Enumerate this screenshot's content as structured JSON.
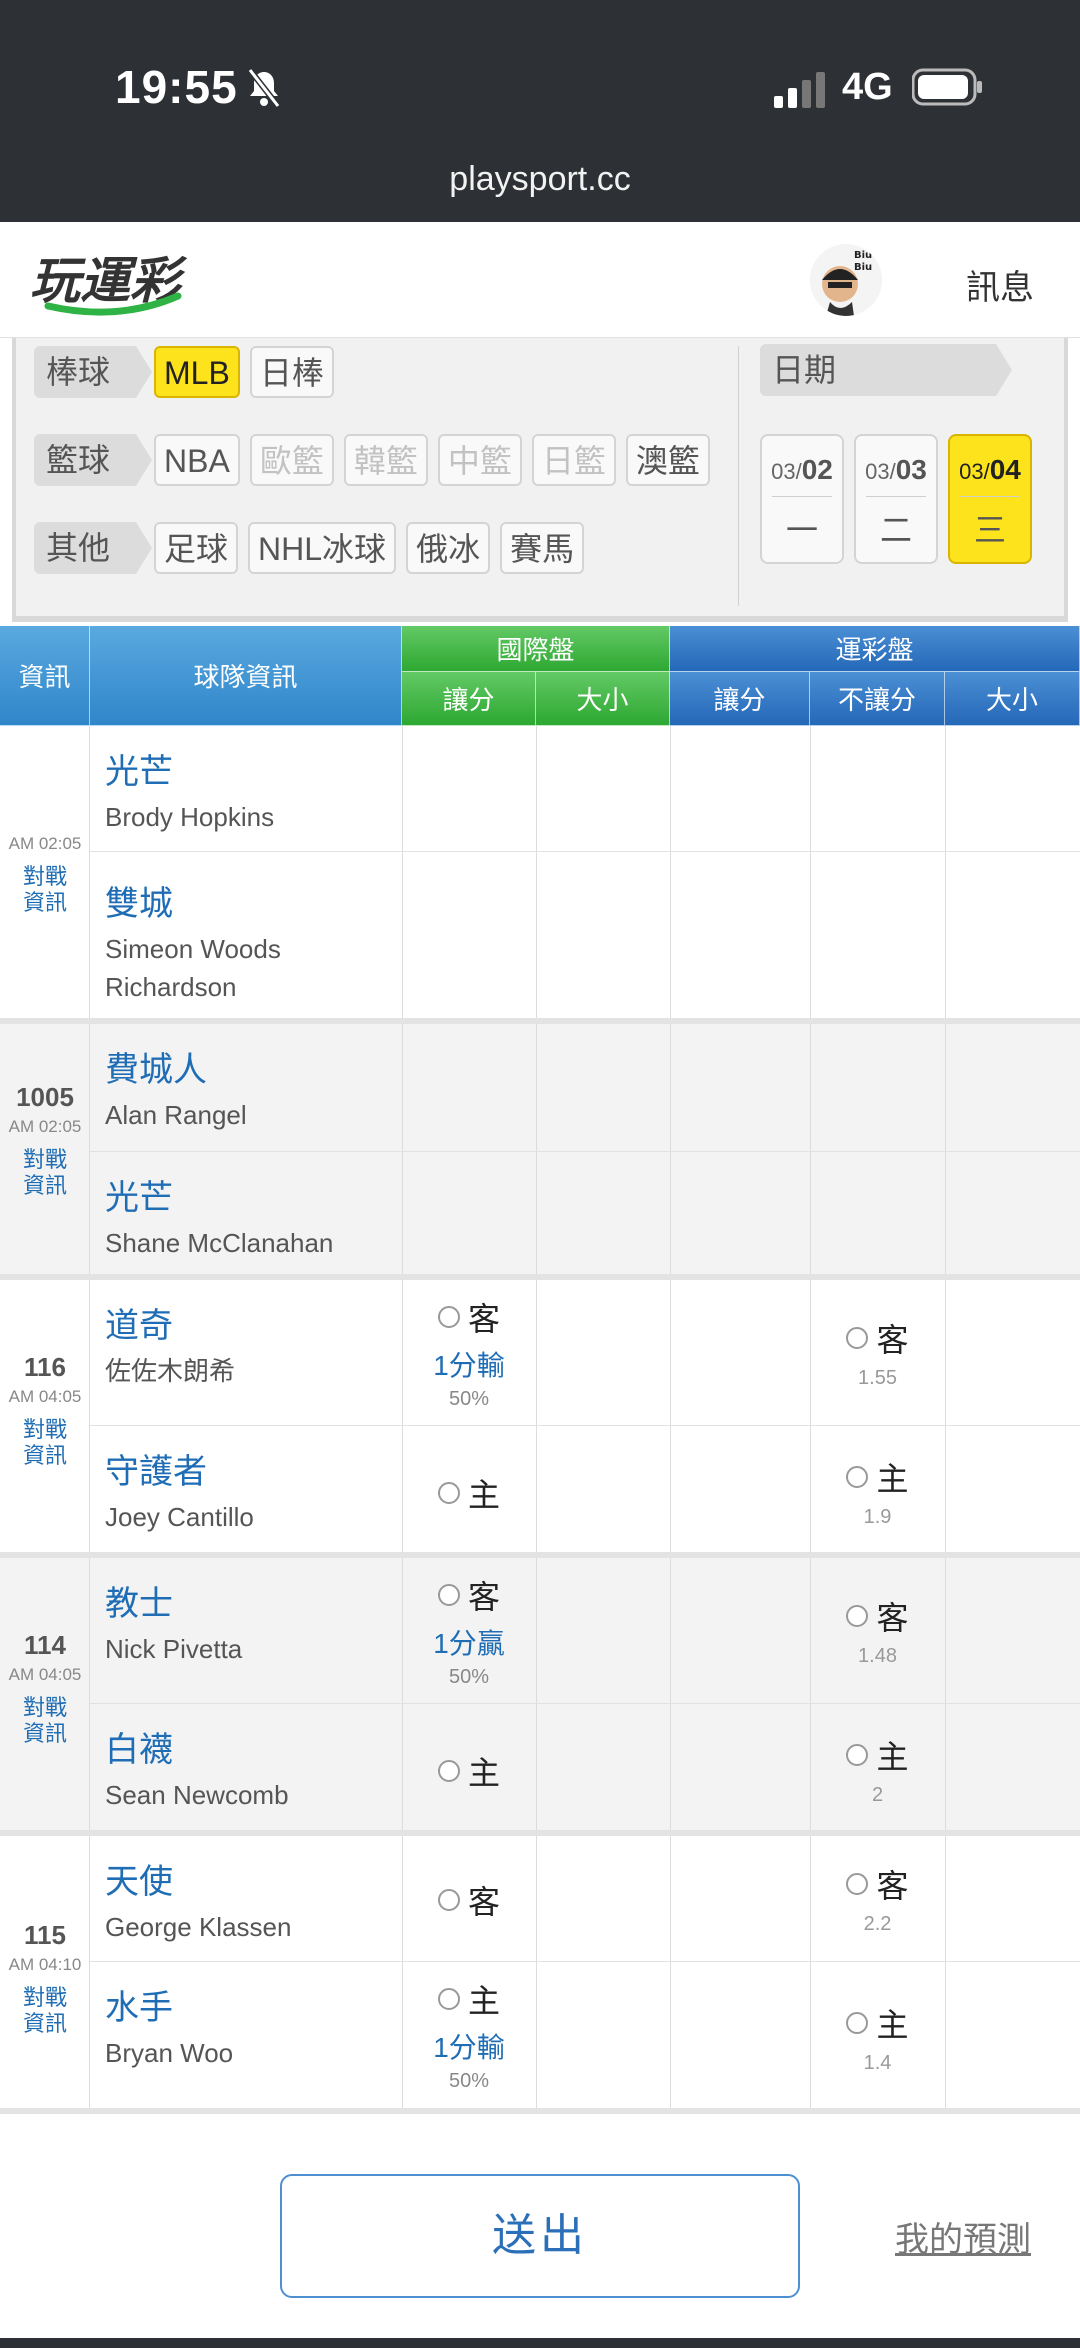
{
  "status_bar": {
    "time": "19:55",
    "network": "4G"
  },
  "url": "playsport.cc",
  "header": {
    "logo_text": "玩運彩",
    "avatar_text": "Biu Biu",
    "messages_label": "訊息"
  },
  "filters": {
    "rows": [
      {
        "category": "棒球",
        "chips": [
          {
            "label": "MLB",
            "state": "active"
          },
          {
            "label": "日棒",
            "state": "normal"
          }
        ]
      },
      {
        "category": "籃球",
        "chips": [
          {
            "label": "NBA",
            "state": "normal"
          },
          {
            "label": "歐籃",
            "state": "disabled"
          },
          {
            "label": "韓籃",
            "state": "disabled"
          },
          {
            "label": "中籃",
            "state": "disabled"
          },
          {
            "label": "日籃",
            "state": "disabled"
          },
          {
            "label": "澳籃",
            "state": "normal"
          }
        ]
      },
      {
        "category": "其他",
        "chips": [
          {
            "label": "足球",
            "state": "normal"
          },
          {
            "label": "NHL冰球",
            "state": "normal"
          },
          {
            "label": "俄冰",
            "state": "normal"
          },
          {
            "label": "賽馬",
            "state": "normal"
          }
        ]
      }
    ],
    "date_label": "日期",
    "dates": [
      {
        "month": "03/",
        "day": "02",
        "weekday": "一",
        "active": false
      },
      {
        "month": "03/",
        "day": "03",
        "weekday": "二",
        "active": false
      },
      {
        "month": "03/",
        "day": "04",
        "weekday": "三",
        "active": true
      }
    ]
  },
  "table_header": {
    "info": "資訊",
    "team": "球隊資訊",
    "intl": "國際盤",
    "sport": "運彩盤",
    "intl_spread": "讓分",
    "intl_total": "大小",
    "sport_spread": "讓分",
    "sport_nospread": "不讓分",
    "sport_total": "大小"
  },
  "colors": {
    "accent_blue": "#1f6db5",
    "active_yellow": "#fce31c",
    "header_green": "#2ea832",
    "header_blue": "#2f86c9"
  },
  "games": [
    {
      "number": "",
      "time": "AM 02:05",
      "link": "對戰\n資訊",
      "teams": [
        {
          "name": "光芒",
          "pitcher": "Brody Hopkins"
        },
        {
          "name": "雙城",
          "pitcher": "Simeon Woods Richardson"
        }
      ]
    },
    {
      "number": "1005",
      "time": "AM 02:05",
      "link": "對戰\n資訊",
      "teams": [
        {
          "name": "費城人",
          "pitcher": "Alan Rangel"
        },
        {
          "name": "光芒",
          "pitcher": "Shane McClanahan"
        }
      ]
    },
    {
      "number": "116",
      "time": "AM 04:05",
      "link": "對戰\n資訊",
      "teams": [
        {
          "name": "道奇",
          "pitcher": "佐佐木朗希",
          "intl": {
            "side": "客",
            "line": "1分輸",
            "pct": "50%"
          },
          "sport": {
            "side": "客",
            "odds": "1.55"
          }
        },
        {
          "name": "守護者",
          "pitcher": "Joey Cantillo",
          "intl": {
            "side": "主"
          },
          "sport": {
            "side": "主",
            "odds": "1.9"
          }
        }
      ]
    },
    {
      "number": "114",
      "time": "AM 04:05",
      "link": "對戰\n資訊",
      "teams": [
        {
          "name": "教士",
          "pitcher": "Nick Pivetta",
          "intl": {
            "side": "客",
            "line": "1分贏",
            "pct": "50%"
          },
          "sport": {
            "side": "客",
            "odds": "1.48"
          }
        },
        {
          "name": "白襪",
          "pitcher": "Sean Newcomb",
          "intl": {
            "side": "主"
          },
          "sport": {
            "side": "主",
            "odds": "2"
          }
        }
      ]
    },
    {
      "number": "115",
      "time": "AM 04:10",
      "link": "對戰\n資訊",
      "teams": [
        {
          "name": "天使",
          "pitcher": "George Klassen",
          "intl": {
            "side": "客"
          },
          "sport": {
            "side": "客",
            "odds": "2.2"
          }
        },
        {
          "name": "水手",
          "pitcher": "Bryan Woo",
          "intl": {
            "side": "主",
            "line": "1分輸",
            "pct": "50%"
          },
          "sport": {
            "side": "主",
            "odds": "1.4"
          }
        }
      ]
    }
  ],
  "footer": {
    "submit_label": "送出",
    "my_predictions_label": "我的預測"
  }
}
